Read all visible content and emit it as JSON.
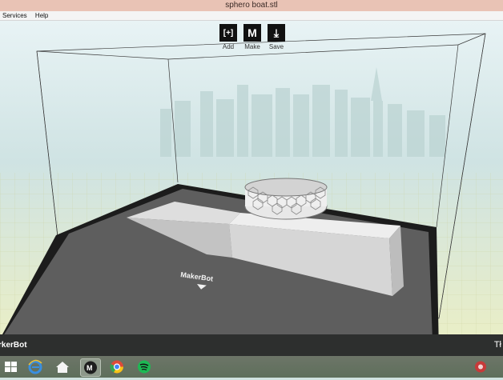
{
  "window": {
    "title": "sphero boat.stl"
  },
  "menu": {
    "items": [
      "Services",
      "Help"
    ]
  },
  "toolbar": {
    "add": {
      "glyph": "[+]",
      "label": "Add"
    },
    "make": {
      "glyph": "M",
      "label": "Make"
    },
    "save": {
      "glyph": "⤓",
      "label": "Save"
    }
  },
  "statusbar": {
    "logo": "rkerBot",
    "right": "Tł"
  },
  "taskbar": {
    "icons": [
      "start-icon",
      "ie-icon",
      "explorer-icon",
      "makerbot-icon",
      "chrome-icon",
      "spotify-icon",
      "tray-icon"
    ]
  },
  "colors": {
    "bed_dark": "#1a1a1a",
    "plate": "#5c5c5c",
    "model": "#e6e6e6",
    "sky": "#d6e9ec",
    "grid": "#f0f0d8"
  }
}
